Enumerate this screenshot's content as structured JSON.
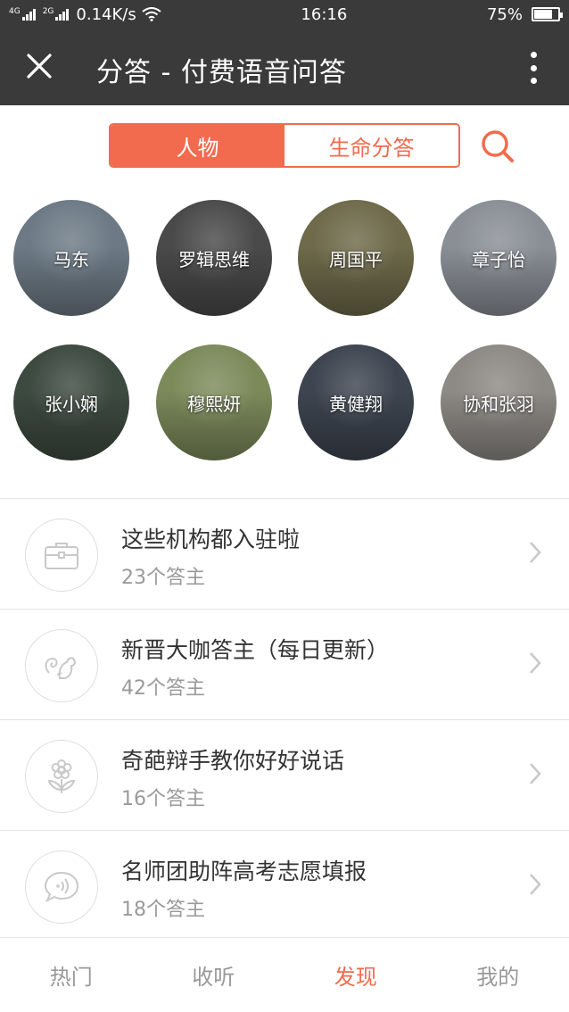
{
  "status_bar": {
    "signal1_tag": "4G",
    "signal2_tag": "2G",
    "net_speed": "0.14K/s",
    "time": "16:16",
    "battery": "75%",
    "battery_level": 0.75
  },
  "header": {
    "title": "分答 - 付费语音问答",
    "close_icon": "close-icon",
    "more_icon": "more-vertical-icon"
  },
  "segment": {
    "tabs": [
      "人物",
      "生命分答"
    ],
    "active_index": 0
  },
  "people": [
    {
      "name": "马东",
      "bg": "#6d7a85"
    },
    {
      "name": "罗辑思维",
      "bg": "#4a4a4a"
    },
    {
      "name": "周国平",
      "bg": "#6e6a4a"
    },
    {
      "name": "章子怡",
      "bg": "#8a8f96"
    },
    {
      "name": "张小娴",
      "bg": "#3d4a40"
    },
    {
      "name": "穆熙妍",
      "bg": "#7c8a5a"
    },
    {
      "name": "黄健翔",
      "bg": "#3e4550"
    },
    {
      "name": "协和张羽",
      "bg": "#8d8a85"
    }
  ],
  "list": [
    {
      "title": "这些机构都入驻啦",
      "sub": "23个答主",
      "icon": "briefcase-icon"
    },
    {
      "title": "新晋大咖答主（每日更新）",
      "sub": "42个答主",
      "icon": "squirrel-icon"
    },
    {
      "title": "奇葩辩手教你好好说话",
      "sub": "16个答主",
      "icon": "flower-icon"
    },
    {
      "title": "名师团助阵高考志愿填报",
      "sub": "18个答主",
      "icon": "voice-bubble-icon"
    }
  ],
  "tabs": [
    {
      "label": "热门"
    },
    {
      "label": "收听"
    },
    {
      "label": "发现"
    },
    {
      "label": "我的"
    }
  ],
  "active_tab": 2,
  "colors": {
    "accent": "#f26b4e",
    "header_bg": "#3a3a3a"
  }
}
